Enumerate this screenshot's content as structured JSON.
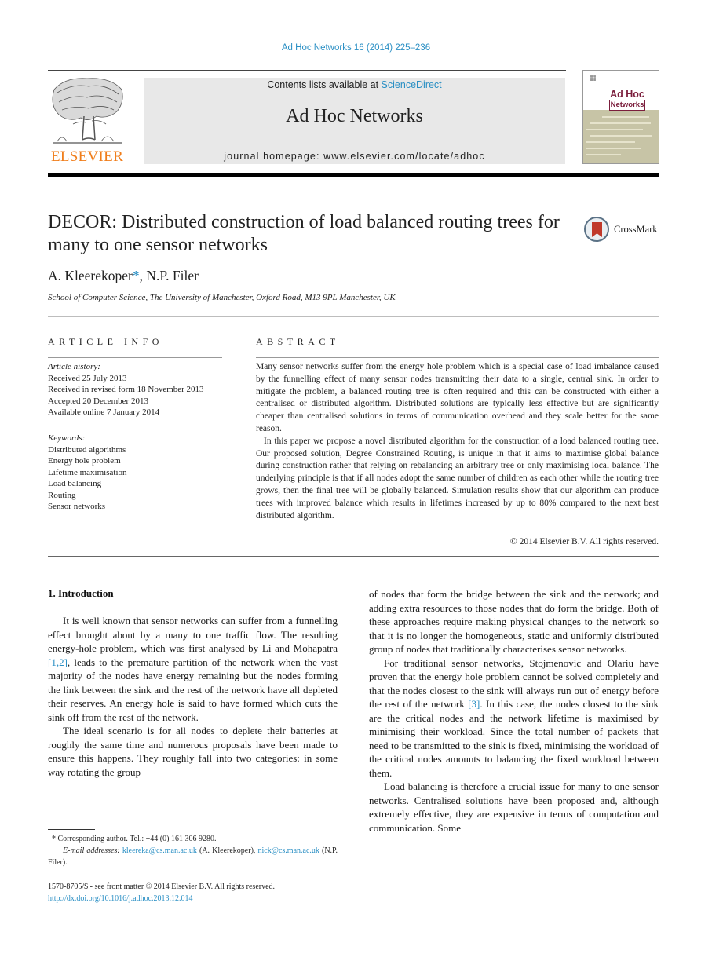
{
  "header": {
    "citation": "Ad Hoc Networks 16 (2014) 225–236",
    "contents_prefix": "Contents lists available at ",
    "contents_link": "ScienceDirect",
    "journal_name": "Ad Hoc Networks",
    "homepage": "journal homepage: www.elsevier.com/locate/adhoc",
    "publisher_logo_text": "ELSEVIER",
    "cover_title_line1": "Ad Hoc",
    "cover_title_line2": "Networks",
    "crossmark_label": "CrossMark"
  },
  "colors": {
    "link": "#2a8fc4",
    "elsevier_orange": "#f07d1a",
    "cover_maroon": "#7b1e3c",
    "masthead_gray": "#e8e8e8"
  },
  "article": {
    "title": "DECOR: Distributed construction of load balanced routing trees for many to one sensor networks",
    "authors": [
      {
        "name": "A. Kleerekoper",
        "marker": "*"
      },
      {
        "name": "N.P. Filer"
      }
    ],
    "author_separator": ", ",
    "affiliation": "School of Computer Science, The University of Manchester, Oxford Road, M13 9PL Manchester, UK"
  },
  "article_info": {
    "heading": "ARTICLE INFO",
    "history_label": "Article history:",
    "history": [
      "Received 25 July 2013",
      "Received in revised form 18 November 2013",
      "Accepted 20 December 2013",
      "Available online 7 January 2014"
    ],
    "keywords_label": "Keywords:",
    "keywords": [
      "Distributed algorithms",
      "Energy hole problem",
      "Lifetime maximisation",
      "Load balancing",
      "Routing",
      "Sensor networks"
    ]
  },
  "abstract": {
    "heading": "ABSTRACT",
    "paragraphs": [
      "Many sensor networks suffer from the energy hole problem which is a special case of load imbalance caused by the funnelling effect of many sensor nodes transmitting their data to a single, central sink. In order to mitigate the problem, a balanced routing tree is often required and this can be constructed with either a centralised or distributed algorithm. Distributed solutions are typically less effective but are significantly cheaper than centralised solutions in terms of communication overhead and they scale better for the same reason.",
      "In this paper we propose a novel distributed algorithm for the construction of a load balanced routing tree. Our proposed solution, Degree Constrained Routing, is unique in that it aims to maximise global balance during construction rather that relying on rebalancing an arbitrary tree or only maximising local balance. The underlying principle is that if all nodes adopt the same number of children as each other while the routing tree grows, then the final tree will be globally balanced. Simulation results show that our algorithm can produce trees with improved balance which results in lifetimes increased by up to 80% compared to the next best distributed algorithm."
    ],
    "copyright": "© 2014 Elsevier B.V. All rights reserved."
  },
  "body": {
    "section_heading": "1. Introduction",
    "left": {
      "p1_before": "It is well known that sensor networks can suffer from a funnelling effect brought about by a many to one traffic flow. The resulting energy-hole problem, which was first analysed by Li and Mohapatra ",
      "p1_ref": "[1,2]",
      "p1_after": ", leads to the premature partition of the network when the vast majority of the nodes have energy remaining but the nodes forming the link between the sink and the rest of the network have all depleted their reserves. An energy hole is said to have formed which cuts the sink off from the rest of the network.",
      "p2": "The ideal scenario is for all nodes to deplete their batteries at roughly the same time and numerous proposals have been made to ensure this happens. They roughly fall into two categories: in some way rotating the group"
    },
    "right": {
      "p1": "of nodes that form the bridge between the sink and the network; and adding extra resources to those nodes that do form the bridge. Both of these approaches require making physical changes to the network so that it is no longer the homogeneous, static and uniformly distributed group of nodes that traditionally characterises sensor networks.",
      "p2_before": "For traditional sensor networks, Stojmenovic and Olariu have proven that the energy hole problem cannot be solved completely and that the nodes closest to the sink will always run out of energy before the rest of the network ",
      "p2_ref": "[3]",
      "p2_after": ". In this case, the nodes closest to the sink are the critical nodes and the network lifetime is maximised by minimising their workload. Since the total number of packets that need to be transmitted to the sink is fixed, minimising the workload of the critical nodes amounts to balancing the fixed workload between them.",
      "p3": "Load balancing is therefore a crucial issue for many to one sensor networks. Centralised solutions have been proposed and, although extremely effective, they are expensive in terms of computation and communication. Some"
    }
  },
  "footnotes": {
    "corresponding_marker": "*",
    "corresponding": "Corresponding author. Tel.: +44 (0) 161 306 9280.",
    "email_label": "E-mail addresses:",
    "email1": "kleereka@cs.man.ac.uk",
    "email1_owner": " (A. Kleerekoper), ",
    "email2": "nick@cs.man.ac.uk",
    "email2_owner": " (N.P. Filer).",
    "front_matter": "1570-8705/$ - see front matter © 2014 Elsevier B.V. All rights reserved.",
    "doi": "http://dx.doi.org/10.1016/j.adhoc.2013.12.014"
  }
}
